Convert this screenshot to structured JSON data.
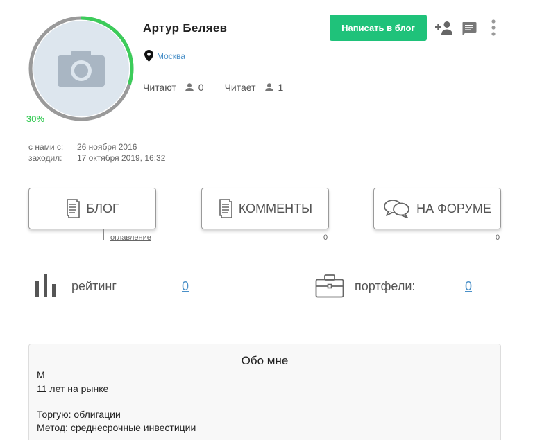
{
  "profile": {
    "name": "Артур Беляев",
    "location": "Москва",
    "progress_label": "30%",
    "progress_fraction": 0.3
  },
  "follow": {
    "followers_label": "Читают",
    "followers_count": "0",
    "following_label": "Читает",
    "following_count": "1"
  },
  "header_actions": {
    "write_blog_label": "Написать в блог",
    "icons": [
      "add-friend-icon",
      "message-icon",
      "more-vert-icon"
    ]
  },
  "meta": {
    "joined_label": "с нами с:",
    "joined_value": "26 ноября 2016",
    "visited_label": "заходил:",
    "visited_value": "17 октября 2019, 16:32"
  },
  "tabs": {
    "blog_label": "БЛОГ",
    "blog_sub": "оглавление",
    "comments_label": "КОММЕНТЫ",
    "comments_count": "0",
    "forum_label": "НА ФОРУМЕ",
    "forum_count": "0"
  },
  "stats": {
    "rating_label": "рейтинг",
    "rating_value": "0",
    "portfolios_label": "портфели:",
    "portfolios_value": "0"
  },
  "about": {
    "title": "Обо мне",
    "line1": "М",
    "line2": "11 лет на рынке",
    "line3": "Торгую: облигации",
    "line4": "Метод: среднесрочные инвестиции"
  },
  "colors": {
    "accent_green": "#1fc27a",
    "progress_green": "#3ccc5a",
    "link_blue": "#4a90c8"
  }
}
